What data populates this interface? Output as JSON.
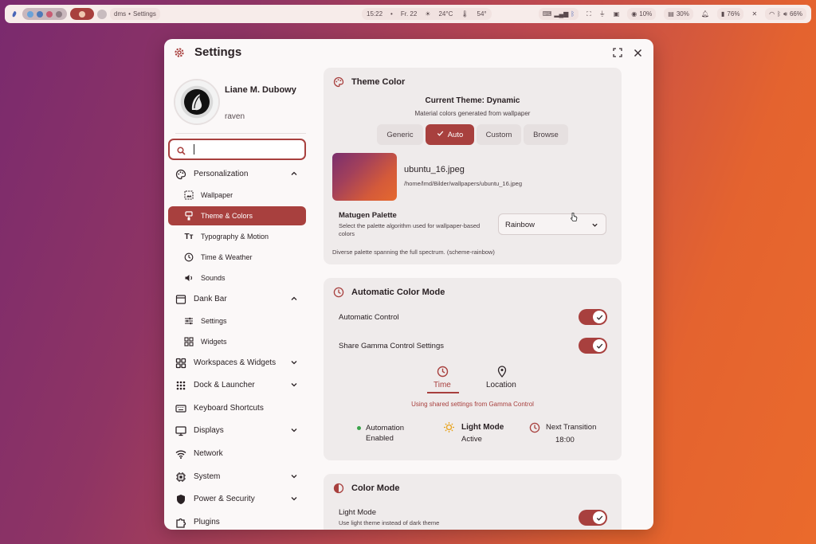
{
  "topbar": {
    "workspace_label": "dms",
    "window_label": "Settings",
    "time": "15:22",
    "date": "Fr. 22",
    "weather": "24°C",
    "temp": "54°",
    "cpu": "10%",
    "mem": "30%",
    "battery": "76%",
    "volume": "66%"
  },
  "window": {
    "title": "Settings",
    "fullscreen_icon": "fullscreen-icon",
    "close_icon": "close-icon"
  },
  "profile": {
    "name": "Liane M. Dubowy",
    "username": "raven"
  },
  "search": {
    "value": ""
  },
  "nav": {
    "personalization": "Personalization",
    "wallpaper": "Wallpaper",
    "theme_colors": "Theme & Colors",
    "typography": "Typography & Motion",
    "time_weather": "Time & Weather",
    "sounds": "Sounds",
    "dank_bar": "Dank Bar",
    "bar_settings": "Settings",
    "widgets": "Widgets",
    "workspaces": "Workspaces & Widgets",
    "dock": "Dock & Launcher",
    "shortcuts": "Keyboard Shortcuts",
    "displays": "Displays",
    "network": "Network",
    "system": "System",
    "power": "Power & Security",
    "plugins": "Plugins"
  },
  "theme_color": {
    "title": "Theme Color",
    "current": "Current Theme: Dynamic",
    "subtitle": "Material colors generated from wallpaper",
    "tabs": [
      "Generic",
      "Auto",
      "Custom",
      "Browse"
    ],
    "selected_tab": "Auto",
    "wallpaper_name": "ubuntu_16.jpeg",
    "wallpaper_path": "/home/lmd/Bilder/wallpapers/ubuntu_16.jpeg",
    "palette_label": "Matugen Palette",
    "palette_desc": "Select the palette algorithm used for wallpaper-based colors",
    "palette_value": "Rainbow",
    "palette_note": "Diverse palette spanning the full spectrum. (scheme-rainbow)"
  },
  "auto_color": {
    "title": "Automatic Color Mode",
    "control_label": "Automatic Control",
    "gamma_label": "Share Gamma Control Settings",
    "tab_time": "Time",
    "tab_location": "Location",
    "shared_note": "Using shared settings from Gamma Control",
    "automation_line1": "Automation",
    "automation_line2": "Enabled",
    "light_mode": "Light Mode",
    "light_state": "Active",
    "next_label": "Next Transition",
    "next_time": "18:00"
  },
  "color_mode": {
    "title": "Color Mode",
    "light_label": "Light Mode",
    "light_desc": "Use light theme instead of dark theme"
  },
  "colors": {
    "accent": "#a8403e",
    "card": "#efebeb",
    "green": "#3aa34a",
    "sun": "#e8a21a"
  }
}
